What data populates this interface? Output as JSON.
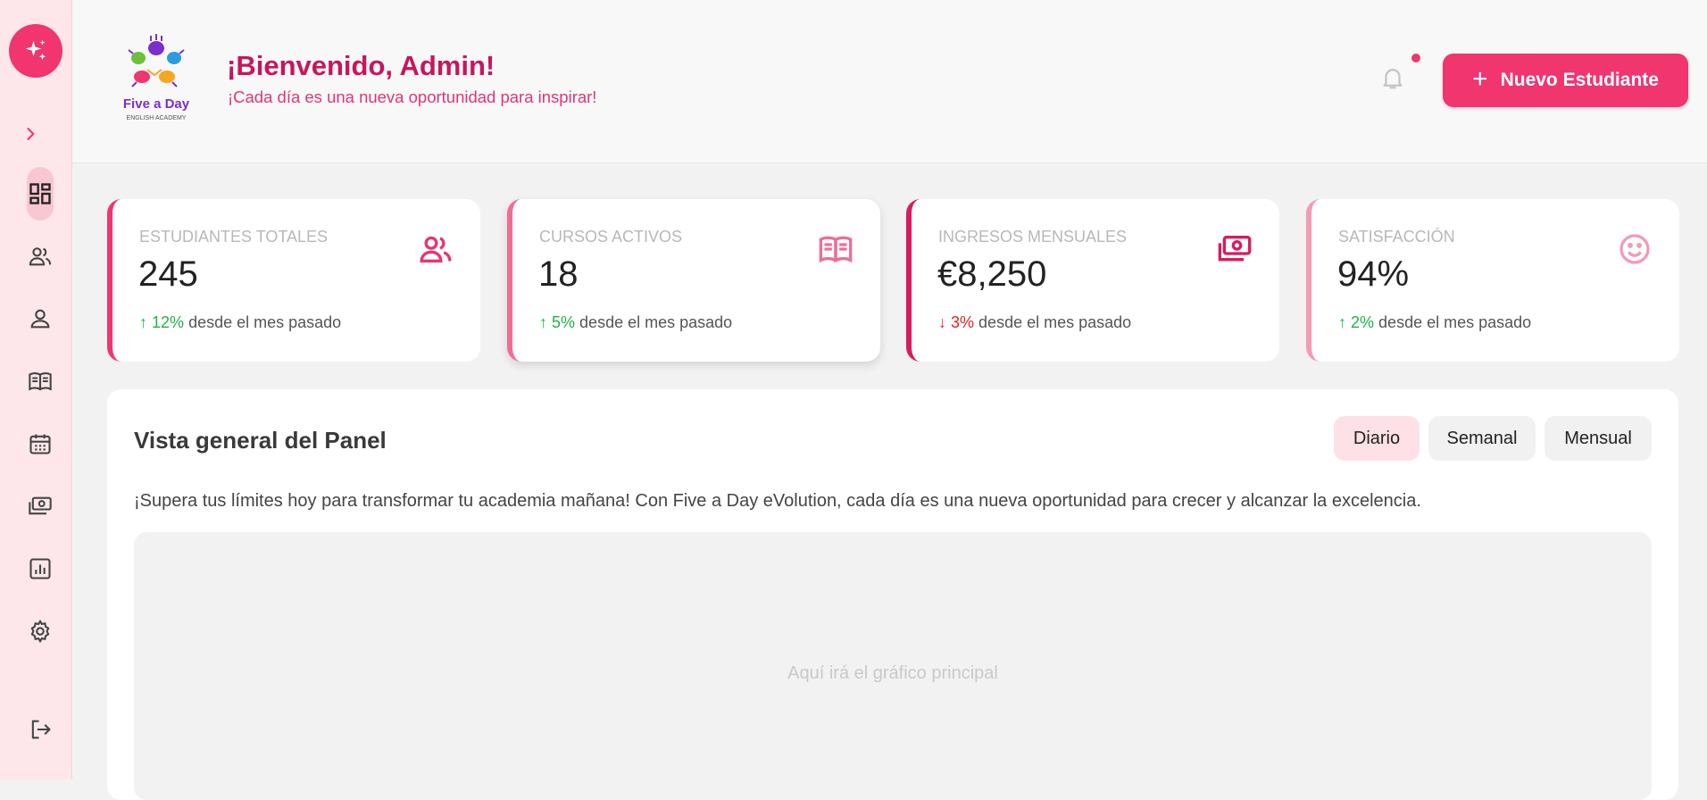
{
  "sidebar": {
    "toggle_icon": "chevron-right-icon",
    "items": [
      {
        "icon": "dashboard-icon",
        "active": true
      },
      {
        "icon": "users-icon",
        "active": false
      },
      {
        "icon": "user-icon",
        "active": false
      },
      {
        "icon": "book-icon",
        "active": false
      },
      {
        "icon": "calendar-icon",
        "active": false
      },
      {
        "icon": "money-icon",
        "active": false
      },
      {
        "icon": "report-icon",
        "active": false
      },
      {
        "icon": "gear-icon",
        "active": false
      }
    ],
    "logout_icon": "logout-icon"
  },
  "header": {
    "logo_text": "Five a Day",
    "logo_subtext": "ENGLISH ACADEMY",
    "title": "¡Bienvenido, Admin!",
    "subtitle": "¡Cada día es una nueva oportunidad para inspirar!",
    "new_button_label": "Nuevo Estudiante",
    "new_button_icon": "+",
    "has_notification": true
  },
  "stats": [
    {
      "label": "ESTUDIANTES TOTALES",
      "value": "245",
      "arrow": "↑",
      "change": "12%",
      "direction": "up",
      "suffix": "desde el mes pasado",
      "icon": "users-icon"
    },
    {
      "label": "CURSOS ACTIVOS",
      "value": "18",
      "arrow": "↑",
      "change": "5%",
      "direction": "up",
      "suffix": "desde el mes pasado",
      "icon": "book-icon"
    },
    {
      "label": "INGRESOS MENSUALES",
      "value": "€8,250",
      "arrow": "↓",
      "change": "3%",
      "direction": "down",
      "suffix": "desde el mes pasado",
      "icon": "money-icon"
    },
    {
      "label": "SATISFACCIÓN",
      "value": "94%",
      "arrow": "↑",
      "change": "2%",
      "direction": "up",
      "suffix": "desde el mes pasado",
      "icon": "smile-icon"
    }
  ],
  "panel": {
    "title": "Vista general del Panel",
    "periods": [
      {
        "label": "Diario",
        "active": true
      },
      {
        "label": "Semanal",
        "active": false
      },
      {
        "label": "Mensual",
        "active": false
      }
    ],
    "description": "¡Supera tus límites hoy para transformar tu academia mañana! Con Five a Day eVolution, cada día es una nueva oportunidad para crecer y alcanzar la excelencia.",
    "chart_placeholder": "Aquí irá el gráfico principal"
  },
  "colors": {
    "accent": "#f0356f",
    "title": "#c8155f",
    "sidebar_bg": "#fde7ea",
    "up": "#22b04a",
    "down": "#e02424"
  }
}
